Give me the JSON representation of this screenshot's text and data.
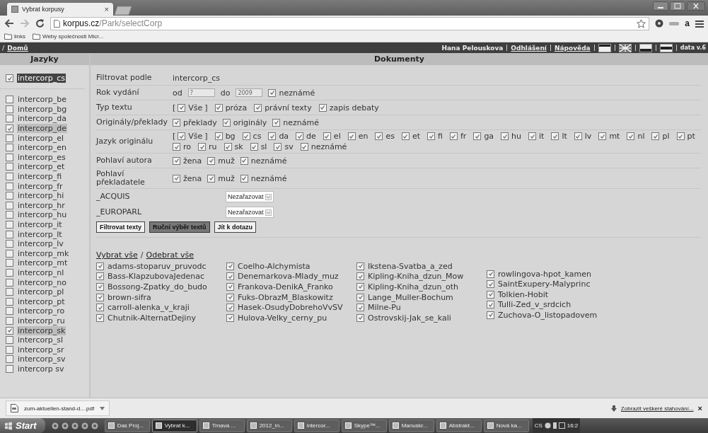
{
  "browser": {
    "tab_title": "Vybrat korpusy",
    "tab_close": "×",
    "url_host": "korpus.cz",
    "url_path": "/Park/selectCorp",
    "toolbar_letter": "a",
    "bookmarks": [
      "links",
      "Weby společnosti Micr..."
    ]
  },
  "nav": {
    "separator": "/",
    "home": "Domů",
    "user": "Hana Pelouskova",
    "links": [
      "Odhlášení",
      "Nápověda"
    ],
    "version": "data v.6"
  },
  "sidebar": {
    "title": "Jazyky",
    "primary": {
      "label": "intercorp_cs",
      "checked": true
    },
    "items": [
      {
        "label": "intercorp_be",
        "checked": false
      },
      {
        "label": "intercorp_bg",
        "checked": false
      },
      {
        "label": "intercorp_da",
        "checked": false
      },
      {
        "label": "intercorp_de",
        "checked": true
      },
      {
        "label": "intercorp_el",
        "checked": false
      },
      {
        "label": "intercorp_en",
        "checked": false
      },
      {
        "label": "intercorp_es",
        "checked": false
      },
      {
        "label": "intercorp_et",
        "checked": false
      },
      {
        "label": "intercorp_fi",
        "checked": false
      },
      {
        "label": "intercorp_fr",
        "checked": false
      },
      {
        "label": "intercorp_hi",
        "checked": false
      },
      {
        "label": "intercorp_hr",
        "checked": false
      },
      {
        "label": "intercorp_hu",
        "checked": false
      },
      {
        "label": "intercorp_it",
        "checked": false
      },
      {
        "label": "intercorp_lt",
        "checked": false
      },
      {
        "label": "intercorp_lv",
        "checked": false
      },
      {
        "label": "intercorp_mk",
        "checked": false
      },
      {
        "label": "intercorp_mt",
        "checked": false
      },
      {
        "label": "intercorp_nl",
        "checked": false
      },
      {
        "label": "intercorp_no",
        "checked": false
      },
      {
        "label": "intercorp_pl",
        "checked": false
      },
      {
        "label": "intercorp_pt",
        "checked": false
      },
      {
        "label": "intercorp_ro",
        "checked": false
      },
      {
        "label": "intercorp_ru",
        "checked": false
      },
      {
        "label": "intercorp_sk",
        "checked": true
      },
      {
        "label": "intercorp_sl",
        "checked": false
      },
      {
        "label": "intercorp_sr",
        "checked": false
      },
      {
        "label": "intercorp_sv",
        "checked": false
      },
      {
        "label": "intercorp sv",
        "checked": false
      }
    ]
  },
  "main": {
    "title": "Dokumenty",
    "filter_rows": [
      {
        "kind": "text",
        "label": "Filtrovat podle",
        "value": "intercorp_cs"
      },
      {
        "kind": "year",
        "label": "Rok vydání",
        "from_label": "od",
        "from_placeholder": "?",
        "to_label": "do",
        "to_placeholder": "2009",
        "unknown": {
          "label": "neznámé",
          "checked": true
        }
      },
      {
        "kind": "checks",
        "label": "Typ textu",
        "bracket_open": "[",
        "bracket_close": "]",
        "options": [
          {
            "label": "Vše",
            "checked": true
          },
          {
            "label": "próza",
            "checked": true
          },
          {
            "label": "právní texty",
            "checked": true
          },
          {
            "label": "zapis debaty",
            "checked": true
          }
        ]
      },
      {
        "kind": "checks",
        "label": "Originály/překlady",
        "options": [
          {
            "label": "překlady",
            "checked": true
          },
          {
            "label": "originály",
            "checked": true
          },
          {
            "label": "neznámé",
            "checked": true
          }
        ]
      },
      {
        "kind": "checks",
        "label": "Jazyk originálu",
        "bracket_open": "[",
        "bracket_close": "]",
        "options": [
          {
            "label": "Vše",
            "checked": true
          },
          {
            "label": "bg",
            "checked": true
          },
          {
            "label": "cs",
            "checked": true
          },
          {
            "label": "da",
            "checked": true
          },
          {
            "label": "de",
            "checked": true
          },
          {
            "label": "el",
            "checked": true
          },
          {
            "label": "en",
            "checked": true
          },
          {
            "label": "es",
            "checked": true
          },
          {
            "label": "et",
            "checked": true
          },
          {
            "label": "fi",
            "checked": true
          },
          {
            "label": "fr",
            "checked": true
          },
          {
            "label": "ga",
            "checked": true
          },
          {
            "label": "hu",
            "checked": true
          },
          {
            "label": "it",
            "checked": true
          },
          {
            "label": "lt",
            "checked": true
          },
          {
            "label": "lv",
            "checked": true
          },
          {
            "label": "mt",
            "checked": true
          },
          {
            "label": "nl",
            "checked": true
          },
          {
            "label": "pl",
            "checked": true
          },
          {
            "label": "pt",
            "checked": true
          },
          {
            "label": "ro",
            "checked": true
          },
          {
            "label": "ru",
            "checked": true
          },
          {
            "label": "sk",
            "checked": true
          },
          {
            "label": "sl",
            "checked": true
          },
          {
            "label": "sv",
            "checked": true
          },
          {
            "label": "neznámé",
            "checked": true
          }
        ]
      },
      {
        "kind": "checks",
        "label": "Pohlaví autora",
        "options": [
          {
            "label": "žena",
            "checked": true
          },
          {
            "label": "muž",
            "checked": true
          },
          {
            "label": "neznámé",
            "checked": true
          }
        ]
      },
      {
        "kind": "checks",
        "label": "Pohlaví překladatele",
        "options": [
          {
            "label": "žena",
            "checked": true
          },
          {
            "label": "muž",
            "checked": true
          },
          {
            "label": "neznámé",
            "checked": true
          }
        ]
      },
      {
        "kind": "select",
        "label": "_ACQUIS",
        "value": "Nezařazovat"
      },
      {
        "kind": "select",
        "label": "_EUROPARL",
        "value": "Nezařazovat"
      }
    ],
    "buttons": [
      {
        "label": "Filtrovat texty",
        "selected": false
      },
      {
        "label": "Ruční výběr textů",
        "selected": true
      },
      {
        "label": "Jít k dotazu",
        "selected": false
      }
    ],
    "select_all": "Vybrat vše",
    "select_separator": "/",
    "deselect_all": "Odebrat vše",
    "document_columns": [
      [
        {
          "label": "adams-stoparuv_pruvodc",
          "checked": true
        },
        {
          "label": "Bass-KlapzubovaJedenac",
          "checked": true
        },
        {
          "label": "Bossong-Zpatky_do_budo",
          "checked": true
        },
        {
          "label": "brown-sifra",
          "checked": true
        },
        {
          "label": "carroll-alenka_v_kraji",
          "checked": true
        },
        {
          "label": "Chutnik-AlternatDejiny",
          "checked": true
        }
      ],
      [
        {
          "label": "Coelho-Alchymista",
          "checked": true
        },
        {
          "label": "Denemarkova-Mlady_muz",
          "checked": true
        },
        {
          "label": "Frankova-DenikA_Franko",
          "checked": true
        },
        {
          "label": "Fuks-ObrazM_Blaskowitz",
          "checked": true
        },
        {
          "label": "Hasek-OsudyDobrehoVvSV",
          "checked": true
        },
        {
          "label": "Hulova-Velky_cerny_pu",
          "checked": true
        }
      ],
      [
        {
          "label": "Ikstena-Svatba_a_zed",
          "checked": true
        },
        {
          "label": "Kipling-Kniha_dzun_Mow",
          "checked": true
        },
        {
          "label": "Kipling-Kniha_dzun_oth",
          "checked": true
        },
        {
          "label": "Lange_Muller-Bochum",
          "checked": true
        },
        {
          "label": "Milne-Pu",
          "checked": true
        },
        {
          "label": "Ostrovskij-Jak_se_kali",
          "checked": true
        }
      ],
      [
        {
          "label": "rowlingova-hpot_kamen",
          "checked": true
        },
        {
          "label": "SaintExupery-Malyprinc",
          "checked": true
        },
        {
          "label": "Tolkien-Hobit",
          "checked": true
        },
        {
          "label": "Tulli-Zed_v_srdcich",
          "checked": true
        },
        {
          "label": "Zuchova-O_listopadovem",
          "checked": true
        }
      ]
    ]
  },
  "downloads": {
    "file": "zum-aktuellen-stand-d....pdf",
    "show_all": "Zobrazit veškeré stahování...",
    "close": "×"
  },
  "taskbar": {
    "start": "Start",
    "tasks": [
      {
        "label": "Das Proj...",
        "selected": false
      },
      {
        "label": "Vybrat k...",
        "selected": true
      },
      {
        "label": "Trnava ...",
        "selected": false
      },
      {
        "label": "2012_in...",
        "selected": false
      },
      {
        "label": "intercor...",
        "selected": false
      },
      {
        "label": "Skype™...",
        "selected": false
      },
      {
        "label": "Manuskr...",
        "selected": false
      },
      {
        "label": "Abstrakt...",
        "selected": false
      },
      {
        "label": "Nová ka...",
        "selected": false
      }
    ],
    "language": "CS",
    "clock": "16:2"
  }
}
